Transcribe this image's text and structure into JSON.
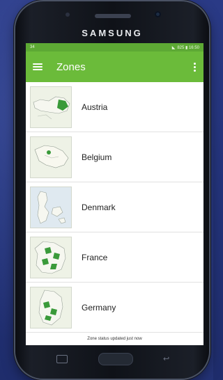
{
  "device": {
    "brand": "SAMSUNG"
  },
  "statusbar": {
    "left": "34",
    "right": "825 ▮ 16:50"
  },
  "appbar": {
    "title": "Zones"
  },
  "zones": [
    {
      "label": "Austria"
    },
    {
      "label": "Belgium"
    },
    {
      "label": "Denmark"
    },
    {
      "label": "France"
    },
    {
      "label": "Germany"
    }
  ],
  "footer": {
    "status": "Zone status updated just now"
  },
  "colors": {
    "appbar": "#6bbb3a",
    "statusbar": "#5da934",
    "zone_fill": "#3a9a3a"
  }
}
